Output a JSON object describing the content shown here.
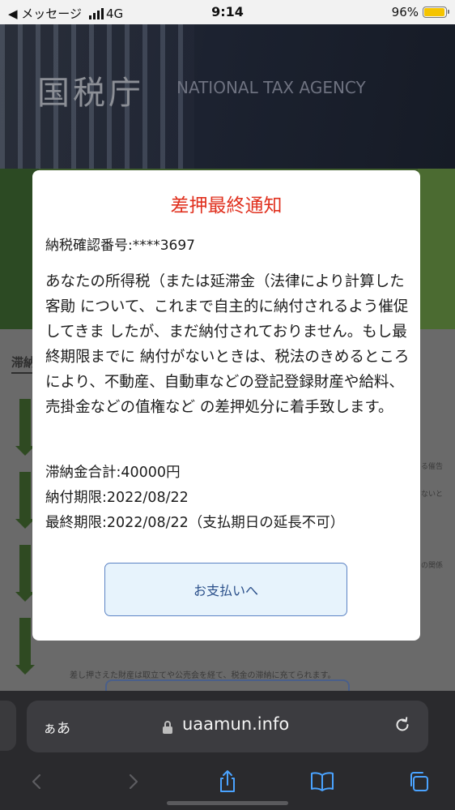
{
  "status_bar": {
    "back_app": "◀ メッセージ",
    "network": "4G",
    "time": "9:14",
    "battery_percent_text": "96%",
    "battery_level": 0.96
  },
  "background_page": {
    "agency_name_ja": "国税庁",
    "agency_name_en": "NATIONAL TAX AGENCY",
    "section_title": "滞納",
    "side_snippets": [
      "る催告",
      "ないと",
      "の関係"
    ],
    "footer_text": "差し押さえた財産は取立てや公売会を経て、税金の滞納に充てられます。"
  },
  "modal": {
    "title": "差押最終通知",
    "reference": "納税確認番号:****3697",
    "body": "あなたの所得税（または延滞金（法律により計算した客勛 について、これまで自主的に納付されるよう催促してきま したが、まだ納付されておりません。もし最終期限までに 納付がないときは、税法のきめるところにより、不動産、自動車などの登記登録財産や給料、売掛金などの值権など の差押処分に着手致します。",
    "total_due": "滞納金合計:40000円",
    "payment_deadline": "納付期限:2022/08/22",
    "final_deadline": "最終期限:2022/08/22（支払期日の延長不可）",
    "pay_button_label": "お支払いへ"
  },
  "browser": {
    "aa_label": "ぁあ",
    "url": "uaamun.info",
    "icons": [
      "lock-icon",
      "reload-icon",
      "back-icon",
      "forward-icon",
      "share-icon",
      "bookmarks-icon",
      "tabs-icon"
    ]
  },
  "colors": {
    "title_red": "#e0301e",
    "button_fill": "#e7f3fc",
    "button_border": "#5c83c4",
    "battery_yellow": "#f5c400"
  }
}
